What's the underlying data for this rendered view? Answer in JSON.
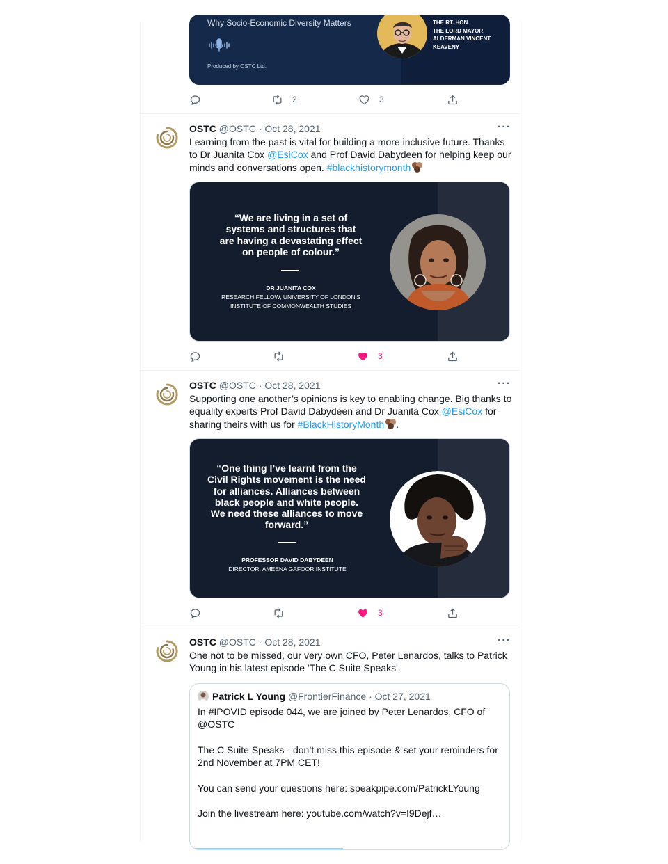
{
  "first_card": {
    "title": "Why Socio-Economic Diversity Matters",
    "produced_by": "Produced by OSTC Ltd.",
    "caption": [
      "THE RT. HON.",
      "THE LORD MAYOR",
      "ALDERMAN VINCENT",
      "KEAVENY"
    ],
    "retweets": "2",
    "likes": "3"
  },
  "tweets": [
    {
      "name": "OSTC",
      "handle": "@OSTC",
      "date": "· Oct 28, 2021",
      "more": "···",
      "text_a": "Learning from the past is vital for building a more inclusive future. Thanks to Dr Juanita Cox ",
      "mention": "@EsiCox",
      "text_b": " and Prof David Dabydeen for helping keep our minds and conversations open. ",
      "hashtag": "#blackhistorymonth",
      "text_c": "",
      "card": {
        "quote": "“We are living in a set of systems and structures that are having a devastating effect on people of colour.”",
        "person": "DR JUANITA COX",
        "role_1": "RESEARCH FELLOW, UNIVERSITY OF LONDON'S",
        "role_2": "INSTITUTE OF COMMONWEALTH STUDIES"
      },
      "likes": "3"
    },
    {
      "name": "OSTC",
      "handle": "@OSTC",
      "date": "· Oct 28, 2021",
      "more": "···",
      "text_a": "Supporting one another’s opinions is key to enabling change. Big thanks to equality experts Prof David Dabydeen and Dr Juanita Cox ",
      "mention": "@EsiCox",
      "text_b": " for sharing theirs with us for ",
      "hashtag": "#BlackHistoryMonth",
      "text_c": ".",
      "card": {
        "quote": "“One thing I’ve learnt from the Civil Rights movement is the need for alliances. Alliances between black people and white people. We need these alliances to move forward.”",
        "person": "PROFESSOR DAVID DABYDEEN",
        "role_1": "DIRECTOR, AMEENA GAFOOR INSTITUTE",
        "role_2": ""
      },
      "likes": "3"
    },
    {
      "name": "OSTC",
      "handle": "@OSTC",
      "date": "· Oct 28, 2021",
      "more": "···",
      "text": "One not to be missed, our very own CFO, Peter Lenardos, talks to Patrick Young in his latest episode 'The C Suite Speaks'.",
      "quoted": {
        "name": "Patrick L Young",
        "handle": "@FrontierFinance",
        "date": "· Oct 27, 2021",
        "paragraphs": [
          "In #IPOVID episode 044, we are joined by Peter Lenardos, CFO of @OSTC",
          "The C Suite Speaks - don’t miss this episode & set your reminders for 2nd November at 7PM CET!",
          "You can send your questions here: speakpipe.com/PatrickLYoung",
          "Join the livestream here: youtube.com/watch?v=I9Dejf…"
        ]
      }
    }
  ],
  "icons": [
    "reply-icon",
    "retweet-icon",
    "like-icon",
    "share-icon",
    "microphone-icon",
    "ostc-logo"
  ],
  "colors": {
    "link": "#1d9bf0",
    "like": "#f91880",
    "muted": "#536471",
    "card_bg": "#141d2e"
  }
}
